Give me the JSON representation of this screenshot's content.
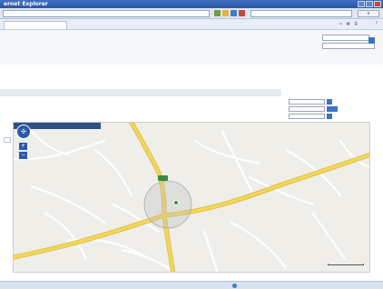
{
  "browser": {
    "title": "ernet Explorer",
    "address": "",
    "search_placeholder": "",
    "zoom": ""
  },
  "site": {
    "nav": "",
    "search_label": "",
    "search_label2": "",
    "advanced_link": ""
  },
  "side_panel": {},
  "map": {
    "tabs": [],
    "submenu": [],
    "bar_text": "",
    "zoom_in": "+",
    "zoom_out": "−",
    "scale": "",
    "copyright": "",
    "marker_label": ""
  },
  "status": {
    "zone": "",
    "zoom": ""
  },
  "colors": {
    "road_major": "#f2d65a",
    "road_minor": "#ffffff",
    "map_bg": "#efeee9",
    "accent": "#3b73c4"
  }
}
